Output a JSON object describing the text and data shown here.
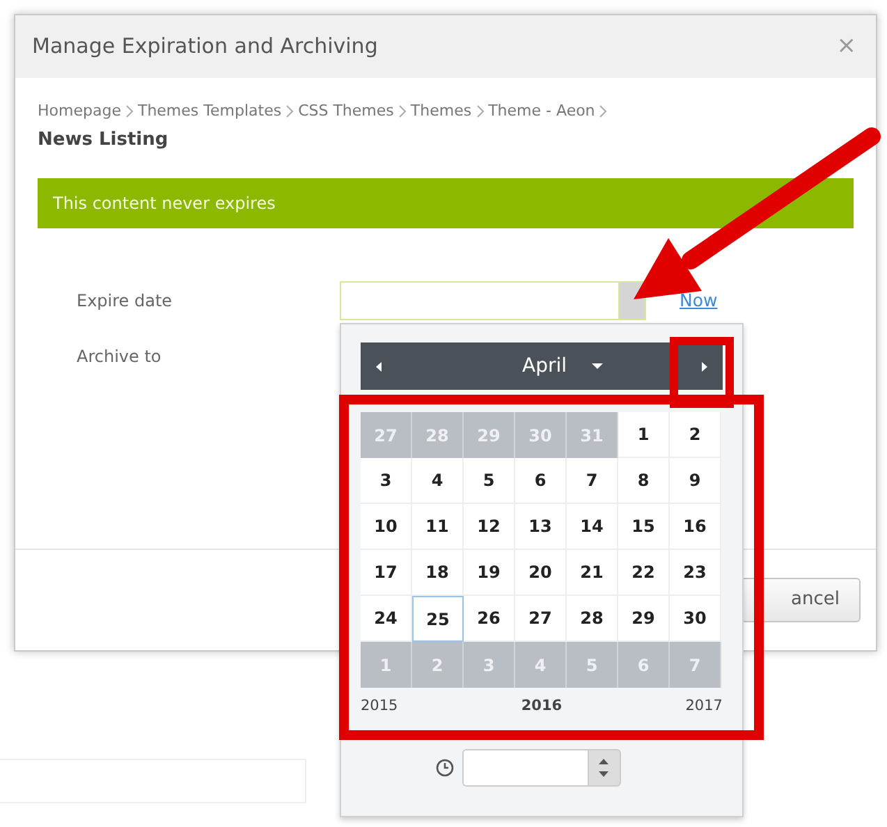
{
  "dialog": {
    "title": "Manage Expiration and Archiving",
    "close": "×",
    "breadcrumb": [
      "Homepage",
      "Themes Templates",
      "CSS Themes",
      "Themes",
      "Theme - Aeon"
    ],
    "page_title": "News Listing",
    "status_message": "This content never expires",
    "fields": [
      {
        "label": "Expire date",
        "kind": "date"
      },
      {
        "label": "Archive to",
        "kind": "text"
      }
    ],
    "now_link": "Now",
    "cancel_button": "ancel"
  },
  "datepicker": {
    "month": "April",
    "weeks": [
      [
        {
          "day": "27",
          "kind": "other",
          "selected": false
        },
        {
          "day": "28",
          "kind": "other",
          "selected": false
        },
        {
          "day": "29",
          "kind": "other",
          "selected": false
        },
        {
          "day": "30",
          "kind": "other",
          "selected": false
        },
        {
          "day": "31",
          "kind": "other",
          "selected": false
        },
        {
          "day": "1",
          "kind": "current",
          "selected": false
        },
        {
          "day": "2",
          "kind": "current",
          "selected": false
        }
      ],
      [
        {
          "day": "3",
          "kind": "current",
          "selected": false
        },
        {
          "day": "4",
          "kind": "current",
          "selected": false
        },
        {
          "day": "5",
          "kind": "current",
          "selected": false
        },
        {
          "day": "6",
          "kind": "current",
          "selected": false
        },
        {
          "day": "7",
          "kind": "current",
          "selected": false
        },
        {
          "day": "8",
          "kind": "current",
          "selected": false
        },
        {
          "day": "9",
          "kind": "current",
          "selected": false
        }
      ],
      [
        {
          "day": "10",
          "kind": "current",
          "selected": false
        },
        {
          "day": "11",
          "kind": "current",
          "selected": false
        },
        {
          "day": "12",
          "kind": "current",
          "selected": false
        },
        {
          "day": "13",
          "kind": "current",
          "selected": false
        },
        {
          "day": "14",
          "kind": "current",
          "selected": false
        },
        {
          "day": "15",
          "kind": "current",
          "selected": false
        },
        {
          "day": "16",
          "kind": "current",
          "selected": false
        }
      ],
      [
        {
          "day": "17",
          "kind": "current",
          "selected": false
        },
        {
          "day": "18",
          "kind": "current",
          "selected": false
        },
        {
          "day": "19",
          "kind": "current",
          "selected": false
        },
        {
          "day": "20",
          "kind": "current",
          "selected": false
        },
        {
          "day": "21",
          "kind": "current",
          "selected": false
        },
        {
          "day": "22",
          "kind": "current",
          "selected": false
        },
        {
          "day": "23",
          "kind": "current",
          "selected": false
        }
      ],
      [
        {
          "day": "24",
          "kind": "current",
          "selected": false
        },
        {
          "day": "25",
          "kind": "current",
          "selected": true
        },
        {
          "day": "26",
          "kind": "current",
          "selected": false
        },
        {
          "day": "27",
          "kind": "current",
          "selected": false
        },
        {
          "day": "28",
          "kind": "current",
          "selected": false
        },
        {
          "day": "29",
          "kind": "current",
          "selected": false
        },
        {
          "day": "30",
          "kind": "current",
          "selected": false
        }
      ],
      [
        {
          "day": "1",
          "kind": "other",
          "selected": false
        },
        {
          "day": "2",
          "kind": "other",
          "selected": false
        },
        {
          "day": "3",
          "kind": "other",
          "selected": false
        },
        {
          "day": "4",
          "kind": "other",
          "selected": false
        },
        {
          "day": "5",
          "kind": "other",
          "selected": false
        },
        {
          "day": "6",
          "kind": "other",
          "selected": false
        },
        {
          "day": "7",
          "kind": "other",
          "selected": false
        }
      ]
    ],
    "years": {
      "previous": "2015",
      "current": "2016",
      "next": "2017"
    }
  }
}
